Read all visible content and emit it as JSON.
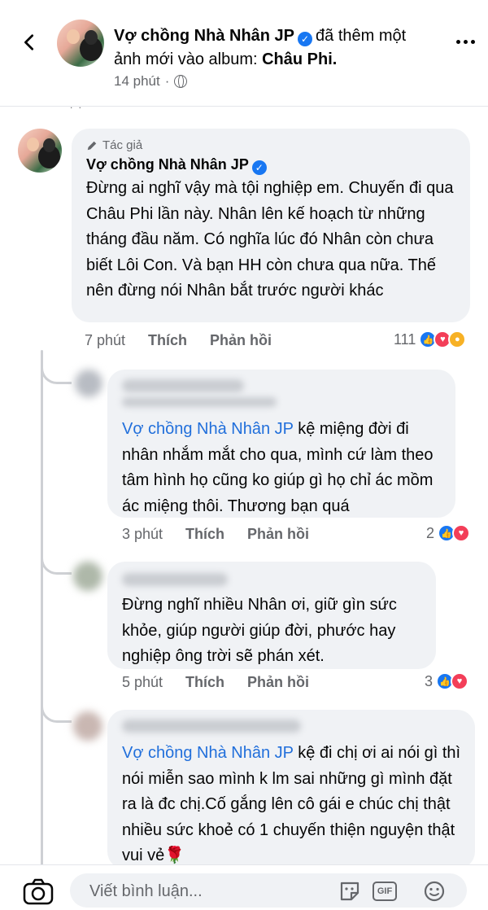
{
  "header": {
    "page_name": "Vợ chồng Nhà Nhân JP",
    "action_text": "đã thêm một ảnh mới vào album:",
    "album_name": "Châu Phi.",
    "time": "14 phút"
  },
  "main_comment": {
    "author_badge": "Tác giả",
    "name": "Vợ chồng Nhà Nhân JP",
    "text": "Đừng ai nghĩ vậy mà tội nghiệp em. Chuyến đi qua Châu Phi lần này. Nhân lên kế hoạch từ những tháng đầu năm. Có nghĩa lúc đó Nhân còn chưa biết Lôi Con. Và bạn HH còn chưa qua nữa. Thế nên đừng nói Nhân bắt trước người khác",
    "time": "7 phút",
    "like_label": "Thích",
    "reply_label": "Phản hồi",
    "reaction_count": "111"
  },
  "replies": [
    {
      "mention": "Vợ chồng Nhà Nhân JP",
      "text": " kệ miệng đời đi nhân nhắm mắt cho qua, mình cứ làm theo tâm hình họ cũng ko giúp gì họ chỉ ác mồm ác miệng thôi. Thương bạn quá",
      "time": "3 phút",
      "like_label": "Thích",
      "reply_label": "Phản hồi",
      "reaction_count": "2"
    },
    {
      "mention": "",
      "text": "Đừng nghĩ nhiều Nhân ơi, giữ gìn sức khỏe, giúp người giúp đời, phước hay nghiệp ông trời sẽ phán xét.",
      "time": "5 phút",
      "like_label": "Thích",
      "reply_label": "Phản hồi",
      "reaction_count": "3"
    },
    {
      "mention": "Vợ chồng Nhà Nhân JP",
      "text": " kệ đi chị ơi ai nói gì thì nói miễn sao mình k lm sai những gì mình đặt ra  là đc chị.Cố gắng lên cô gái e chúc chị thật nhiều sức khoẻ có 1 chuyến thiện nguyện thật vui vẻ🌹"
    }
  ],
  "composer": {
    "placeholder": "Viết bình luận...",
    "gif_label": "GIF"
  },
  "colors": {
    "verified_blue": "#1877f2",
    "mention_blue": "#216fdb",
    "bubble_gray": "#f0f2f5",
    "love_red": "#f33e58"
  }
}
